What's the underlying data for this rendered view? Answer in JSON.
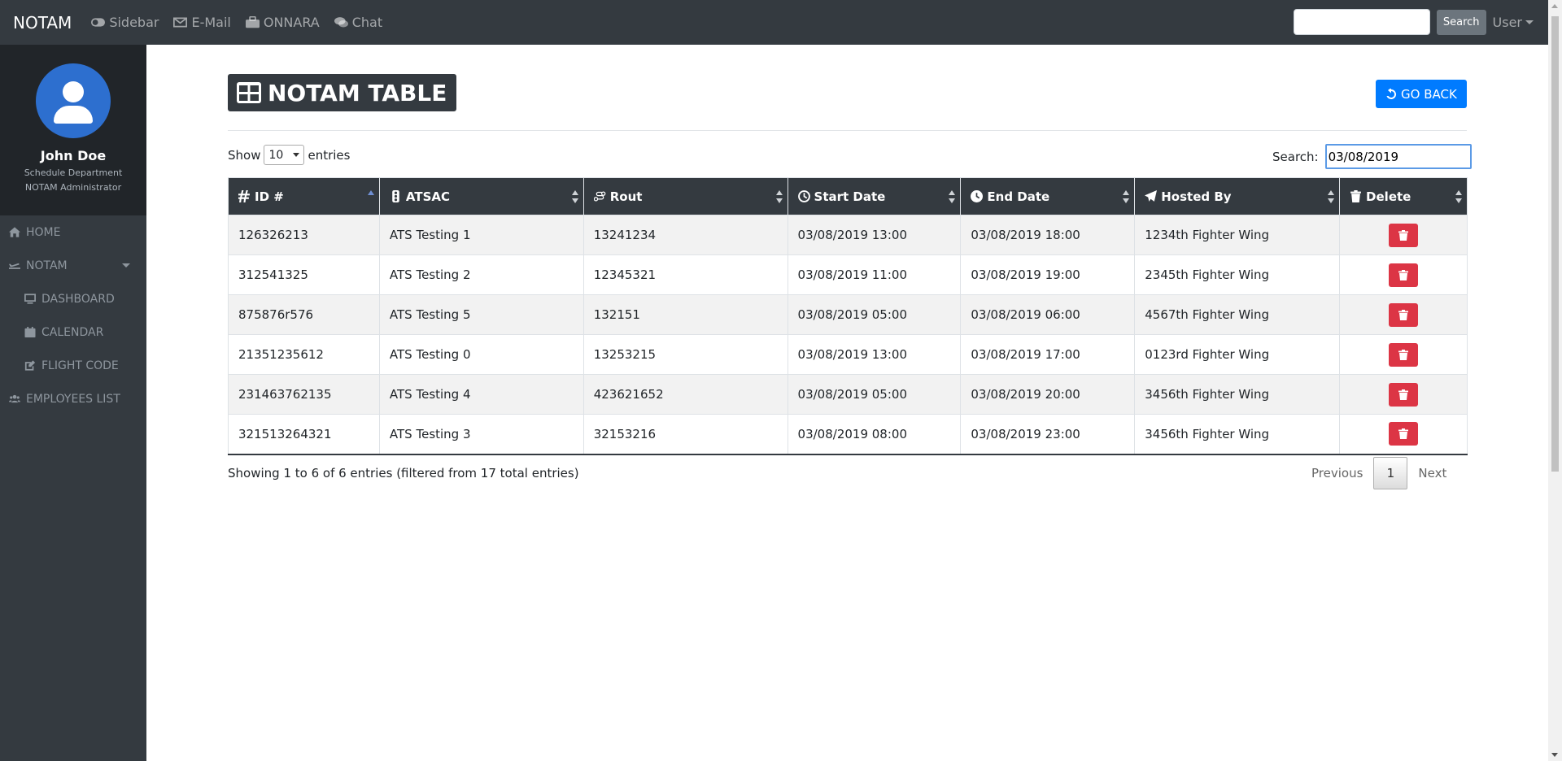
{
  "navbar": {
    "brand": "NOTAM",
    "links": [
      {
        "label": "Sidebar",
        "icon": "toggle-icon"
      },
      {
        "label": "E-Mail",
        "icon": "envelope-icon"
      },
      {
        "label": "ONNARA",
        "icon": "briefcase-icon"
      },
      {
        "label": "Chat",
        "icon": "comments-icon"
      }
    ],
    "search_placeholder": "",
    "search_button": "Search",
    "user_label": "User"
  },
  "sidebar": {
    "profile": {
      "name": "John Doe",
      "department": "Schedule Department",
      "role": "NOTAM Administrator"
    },
    "items": [
      {
        "label": "HOME",
        "icon": "home-icon"
      },
      {
        "label": "NOTAM",
        "icon": "plane-icon"
      },
      {
        "label": "DASHBOARD",
        "icon": "monitor-icon"
      },
      {
        "label": "CALENDAR",
        "icon": "calendar-icon"
      },
      {
        "label": "FLIGHT CODE",
        "icon": "edit-icon"
      },
      {
        "label": "EMPLOYEES LIST",
        "icon": "users-icon"
      }
    ]
  },
  "main": {
    "title": "NOTAM TABLE",
    "go_back": "GO BACK",
    "show_label": "Show",
    "entries_value": "10",
    "entries_label": "entries",
    "search_label": "Search:",
    "search_value": "03/08/2019",
    "table": {
      "headers": [
        "ID #",
        "ATSAC",
        "Rout",
        "Start Date",
        "End Date",
        "Hosted By",
        "Delete"
      ],
      "rows": [
        [
          "126326213",
          "ATS Testing 1",
          "13241234",
          "03/08/2019 13:00",
          "03/08/2019 18:00",
          "1234th Fighter Wing"
        ],
        [
          "312541325",
          "ATS Testing 2",
          "12345321",
          "03/08/2019 11:00",
          "03/08/2019 19:00",
          "2345th Fighter Wing"
        ],
        [
          "875876r576",
          "ATS Testing 5",
          "132151",
          "03/08/2019 05:00",
          "03/08/2019 06:00",
          "4567th Fighter Wing"
        ],
        [
          "21351235612",
          "ATS Testing 0",
          "13253215",
          "03/08/2019 13:00",
          "03/08/2019 17:00",
          "0123rd Fighter Wing"
        ],
        [
          "231463762135",
          "ATS Testing 4",
          "423621652",
          "03/08/2019 05:00",
          "03/08/2019 20:00",
          "3456th Fighter Wing"
        ],
        [
          "321513264321",
          "ATS Testing 3",
          "32153216",
          "03/08/2019 08:00",
          "03/08/2019 23:00",
          "3456th Fighter Wing"
        ]
      ]
    },
    "info": "Showing 1 to 6 of 6 entries (filtered from 17 total entries)",
    "pagination": {
      "previous": "Previous",
      "current": "1",
      "next": "Next"
    }
  },
  "colors": {
    "navbar": "#343a40",
    "accent_blue": "#007bff",
    "danger": "#dc3545",
    "avatar": "#2d6fcf"
  }
}
